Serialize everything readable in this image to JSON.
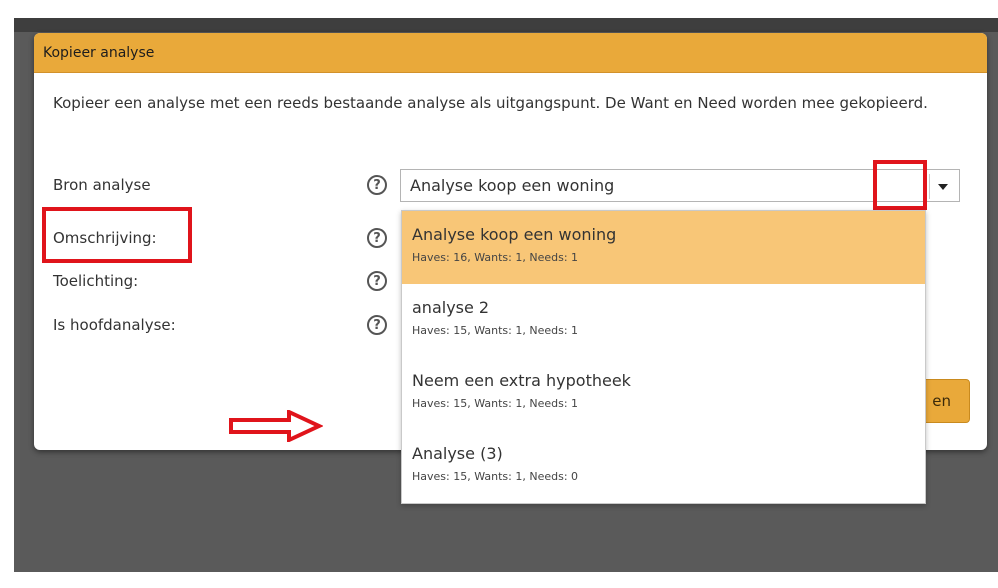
{
  "dialog": {
    "title": "Kopieer analyse",
    "intro": "Kopieer een analyse met een reeds bestaande analyse als uitgangspunt. De Want en Need worden mee gekopieerd."
  },
  "form": {
    "bron_label": "Bron analyse",
    "omschrijving_label": "Omschrijving:",
    "toelichting_label": "Toelichting:",
    "hoofdanalyse_label": "Is hoofdanalyse:",
    "help_glyph": "?",
    "selected_value": "Analyse koop een woning"
  },
  "dropdown": {
    "options": [
      {
        "name": "Analyse koop een woning",
        "stats": "Haves: 16, Wants: 1, Needs: 1"
      },
      {
        "name": "analyse 2",
        "stats": "Haves: 15, Wants: 1, Needs: 1"
      },
      {
        "name": "Neem een extra hypotheek",
        "stats": "Haves: 15, Wants: 1, Needs: 1"
      },
      {
        "name": "Analyse (3)",
        "stats": "Haves: 15, Wants: 1, Needs: 0"
      }
    ]
  },
  "footer": {
    "button_partial_label": "en"
  },
  "colors": {
    "header": "#e9a93a",
    "highlight": "#e0141b",
    "selected_option": "#f8c677"
  }
}
